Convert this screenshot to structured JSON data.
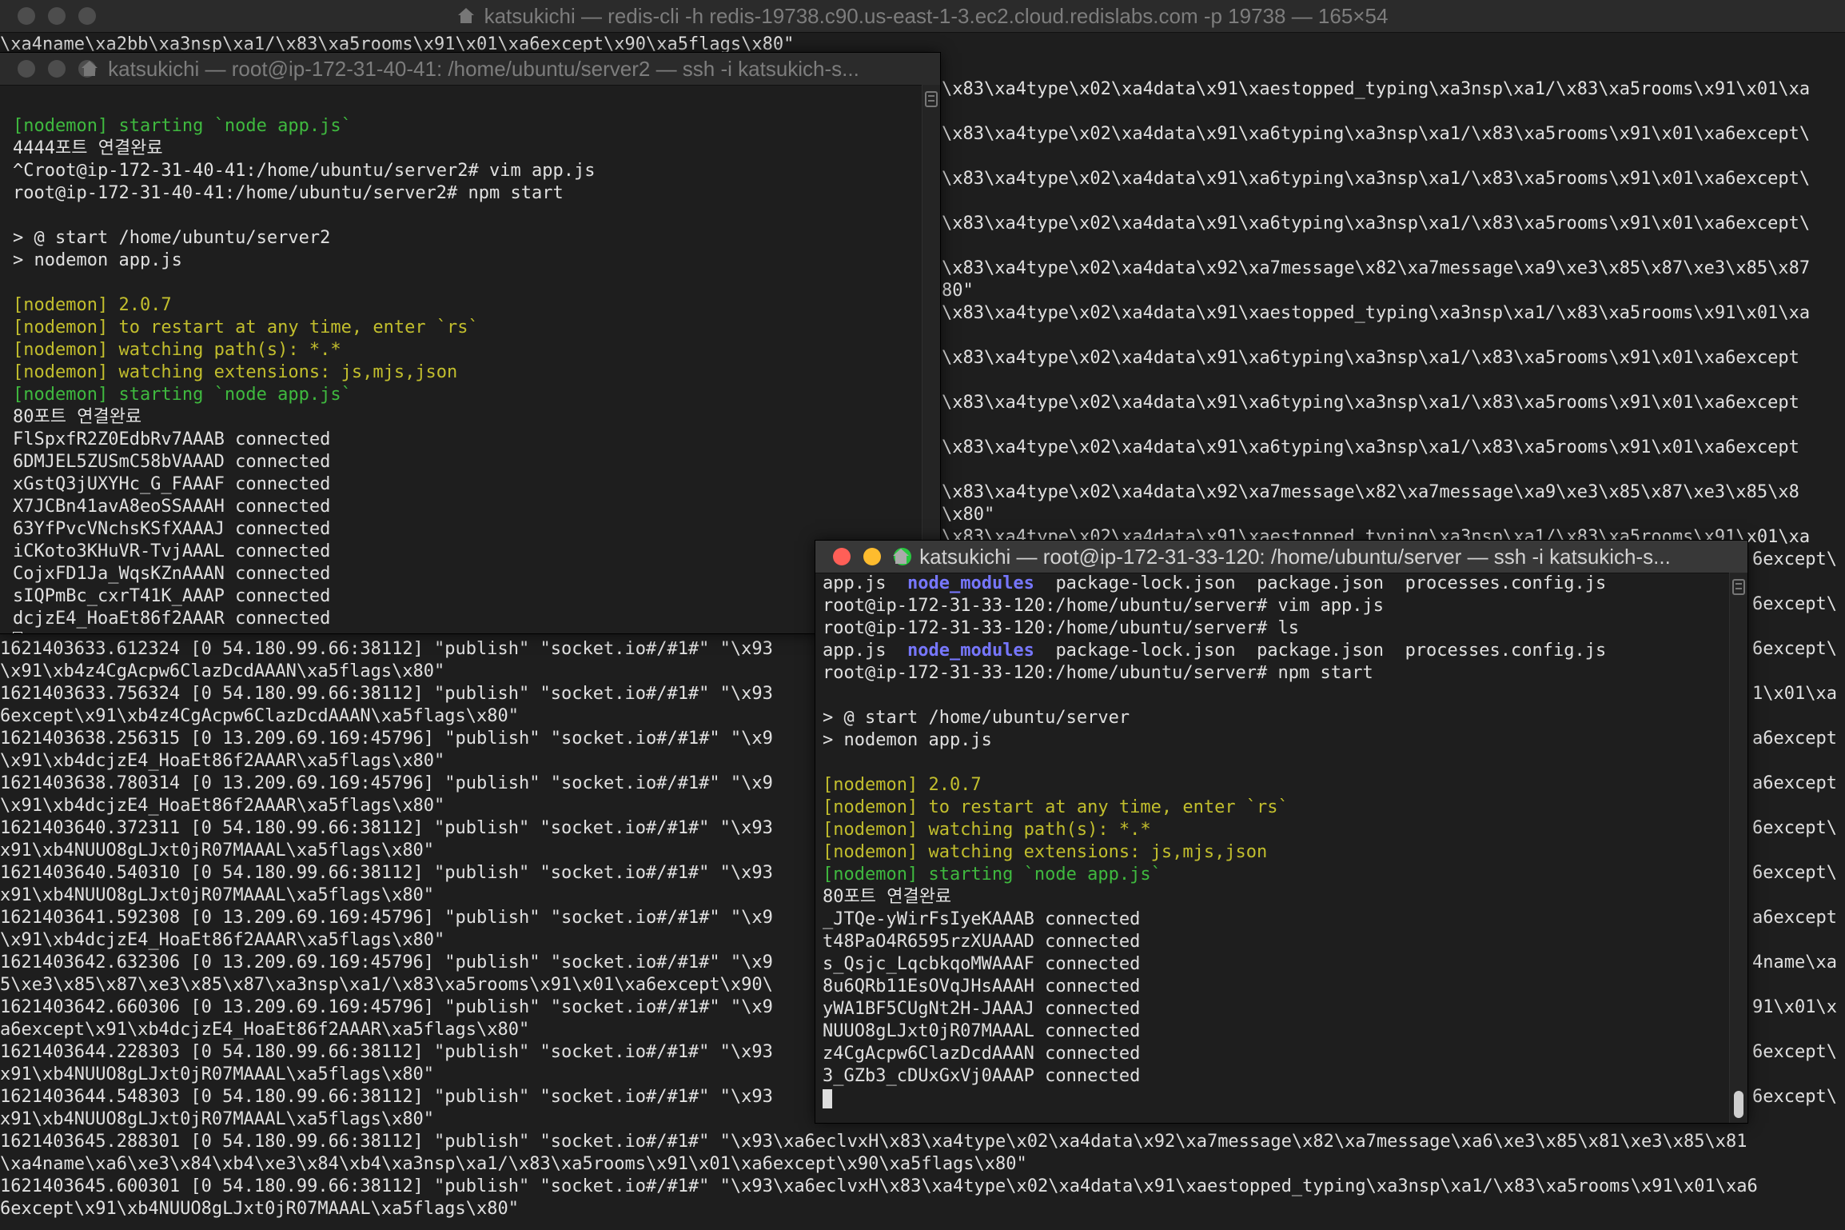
{
  "background_terminal": {
    "title": "katsukichi — redis-cli -h redis-19738.c90.us-east-1-3.ec2.cloud.redislabs.com -p 19738 — 165×54",
    "top_lines": [
      "\\xa4name\\xa2bb\\xa3nsp\\xa1/\\x83\\xa5rooms\\x91\\x01\\xa6except\\x90\\xa5flags\\x80\"",
      "1621403633.612324 [0 54.180.99.66:38112] \"publish\" \"socket.io#/#1#\" \"\\x93\\xa6eclvxH\\x83\\xa4type\\x02\\xa4data\\x91\\xaestopped_typing\\xa3nsp\\xa1/\\x83\\xa5rooms\\x91\\x01\\xa"
    ],
    "right_lines": [
      "",
      "\\x83\\xa4type\\x02\\xa4data\\x91\\xaestopped_typing\\xa3nsp\\xa1/\\x83\\xa5rooms\\x91\\x01\\xa",
      "",
      "\\x83\\xa4type\\x02\\xa4data\\x91\\xa6typing\\xa3nsp\\xa1/\\x83\\xa5rooms\\x91\\x01\\xa6except\\",
      "",
      "\\x83\\xa4type\\x02\\xa4data\\x91\\xa6typing\\xa3nsp\\xa1/\\x83\\xa5rooms\\x91\\x01\\xa6except\\",
      "",
      "\\x83\\xa4type\\x02\\xa4data\\x91\\xa6typing\\xa3nsp\\xa1/\\x83\\xa5rooms\\x91\\x01\\xa6except\\",
      "",
      "\\x83\\xa4type\\x02\\xa4data\\x92\\xa7message\\x82\\xa7message\\xa9\\xe3\\x85\\x87\\xe3\\x85\\x87",
      "80\"",
      "\\x83\\xa4type\\x02\\xa4data\\x91\\xaestopped_typing\\xa3nsp\\xa1/\\x83\\xa5rooms\\x91\\x01\\xa",
      "",
      "\\x83\\xa4type\\x02\\xa4data\\x91\\xa6typing\\xa3nsp\\xa1/\\x83\\xa5rooms\\x91\\x01\\xa6except",
      "",
      "\\x83\\xa4type\\x02\\xa4data\\x91\\xa6typing\\xa3nsp\\xa1/\\x83\\xa5rooms\\x91\\x01\\xa6except",
      "",
      "\\x83\\xa4type\\x02\\xa4data\\x91\\xa6typing\\xa3nsp\\xa1/\\x83\\xa5rooms\\x91\\x01\\xa6except",
      "",
      "\\x83\\xa4type\\x02\\xa4data\\x92\\xa7message\\x82\\xa7message\\xa9\\xe3\\x85\\x87\\xe3\\x85\\x8",
      "\\x80\"",
      "\\x83\\xa4type\\x02\\xa4data\\x91\\xaestopped_typing\\xa3nsp\\xa1/\\x83\\xa5rooms\\x91\\x01\\xa"
    ],
    "lower_left_lines": [
      "1621403633.612324 [0 54.180.99.66:38112] \"publish\" \"socket.io#/#1#\" \"\\x93",
      "\\x91\\xb4z4CgAcpw6ClazDcdAAAN\\xa5flags\\x80\"",
      "1621403633.756324 [0 54.180.99.66:38112] \"publish\" \"socket.io#/#1#\" \"\\x93",
      "6except\\x91\\xb4z4CgAcpw6ClazDcdAAAN\\xa5flags\\x80\"",
      "1621403638.256315 [0 13.209.69.169:45796] \"publish\" \"socket.io#/#1#\" \"\\x9",
      "\\x91\\xb4dcjzE4_HoaEt86f2AAAR\\xa5flags\\x80\"",
      "1621403638.780314 [0 13.209.69.169:45796] \"publish\" \"socket.io#/#1#\" \"\\x9",
      "\\x91\\xb4dcjzE4_HoaEt86f2AAAR\\xa5flags\\x80\"",
      "1621403640.372311 [0 54.180.99.66:38112] \"publish\" \"socket.io#/#1#\" \"\\x93",
      "x91\\xb4NUUO8gLJxt0jR07MAAAL\\xa5flags\\x80\"",
      "1621403640.540310 [0 54.180.99.66:38112] \"publish\" \"socket.io#/#1#\" \"\\x93",
      "x91\\xb4NUUO8gLJxt0jR07MAAAL\\xa5flags\\x80\"",
      "1621403641.592308 [0 13.209.69.169:45796] \"publish\" \"socket.io#/#1#\" \"\\x9",
      "\\x91\\xb4dcjzE4_HoaEt86f2AAAR\\xa5flags\\x80\"",
      "1621403642.632306 [0 13.209.69.169:45796] \"publish\" \"socket.io#/#1#\" \"\\x9",
      "5\\xe3\\x85\\x87\\xe3\\x85\\x87\\xa3nsp\\xa1/\\x83\\xa5rooms\\x91\\x01\\xa6except\\x90\\",
      "1621403642.660306 [0 13.209.69.169:45796] \"publish\" \"socket.io#/#1#\" \"\\x9",
      "a6except\\x91\\xb4dcjzE4_HoaEt86f2AAAR\\xa5flags\\x80\"",
      "1621403644.228303 [0 54.180.99.66:38112] \"publish\" \"socket.io#/#1#\" \"\\x93",
      "x91\\xb4NUUO8gLJxt0jR07MAAAL\\xa5flags\\x80\"",
      "1621403644.548303 [0 54.180.99.66:38112] \"publish\" \"socket.io#/#1#\" \"\\x93",
      "x91\\xb4NUUO8gLJxt0jR07MAAAL\\xa5flags\\x80\""
    ],
    "far_right_lines": [
      "6except\\",
      "",
      "6except\\",
      "",
      "6except\\",
      "",
      "1\\x01\\xa",
      "",
      "a6except",
      "",
      "a6except",
      "",
      "6except\\",
      "",
      "6except\\",
      "",
      "a6except",
      "",
      "4name\\xa",
      "",
      "91\\x01\\x",
      "",
      "6except\\",
      "",
      "6except\\"
    ],
    "bottom_lines": [
      "1621403645.288301 [0 54.180.99.66:38112] \"publish\" \"socket.io#/#1#\" \"\\x93\\xa6eclvxH\\x83\\xa4type\\x02\\xa4data\\x92\\xa7message\\x82\\xa7message\\xa6\\xe3\\x85\\x81\\xe3\\x85\\x81",
      "\\xa4name\\xa6\\xe3\\x84\\xb4\\xe3\\x84\\xb4\\xa3nsp\\xa1/\\x83\\xa5rooms\\x91\\x01\\xa6except\\x90\\xa5flags\\x80\"",
      "1621403645.600301 [0 54.180.99.66:38112] \"publish\" \"socket.io#/#1#\" \"\\x93\\xa6eclvxH\\x83\\xa4type\\x02\\xa4data\\x91\\xaestopped_typing\\xa3nsp\\xa1/\\x83\\xa5rooms\\x91\\x01\\xa6",
      "6except\\x91\\xb4NUUO8gLJxt0jR07MAAAL\\xa5flags\\x80\""
    ]
  },
  "server2_terminal": {
    "title": "katsukichi — root@ip-172-31-40-41: /home/ubuntu/server2 — ssh -i katsukich-s...",
    "lines": [
      "[nodemon] starting `node app.js`",
      "4444포트 연결완료",
      "^Croot@ip-172-31-40-41:/home/ubuntu/server2# vim app.js",
      "root@ip-172-31-40-41:/home/ubuntu/server2# npm start",
      "",
      "> @ start /home/ubuntu/server2",
      "> nodemon app.js",
      "",
      "[nodemon] 2.0.7",
      "[nodemon] to restart at any time, enter `rs`",
      "[nodemon] watching path(s): *.*",
      "[nodemon] watching extensions: js,mjs,json",
      "[nodemon] starting `node app.js`",
      "80포트 연결완료",
      "FlSpxfR2Z0EdbRv7AAAB connected",
      "6DMJEL5ZUSmC58bVAAAD connected",
      "xGstQ3jUXYHc_G_FAAAF connected",
      "X7JCBn41avA8eoSSAAAH connected",
      "63YfPvcVNchsKSfXAAAJ connected",
      "iCKoto3KHuVR-TvjAAAL connected",
      "CojxFD1Ja_WqsKZnAAAN connected",
      "sIQPmBc_cxrT41K_AAAP connected",
      "dcjzE4_HoaEt86f2AAAR connected"
    ]
  },
  "server_terminal": {
    "title": "katsukichi — root@ip-172-31-33-120: /home/ubuntu/server — ssh -i katsukich-s...",
    "ls_files": [
      "app.js",
      "node_modules",
      "package-lock.json",
      "package.json",
      "processes.config.js"
    ],
    "lines": [
      "root@ip-172-31-33-120:/home/ubuntu/server# vim app.js",
      "root@ip-172-31-33-120:/home/ubuntu/server# ls",
      "root@ip-172-31-33-120:/home/ubuntu/server# npm start",
      "",
      "> @ start /home/ubuntu/server",
      "> nodemon app.js",
      "",
      "[nodemon] 2.0.7",
      "[nodemon] to restart at any time, enter `rs`",
      "[nodemon] watching path(s): *.*",
      "[nodemon] watching extensions: js,mjs,json",
      "[nodemon] starting `node app.js`",
      "80포트 연결완료",
      "_JTQe-yWirFsIyeKAAAB connected",
      "t48PaO4R6595rzXUAAAD connected",
      "s_Qsjc_LqcbkqoMWAAAF connected",
      "8u6QRb11EsOVqJHsAAAH connected",
      "yWA1BF5CUgNt2H-JAAAJ connected",
      "NUUO8gLJxt0jR07MAAAL connected",
      "z4CgAcpw6ClazDcdAAAN connected",
      "3_GZb3_cDUxGxVj0AAAP connected"
    ]
  }
}
